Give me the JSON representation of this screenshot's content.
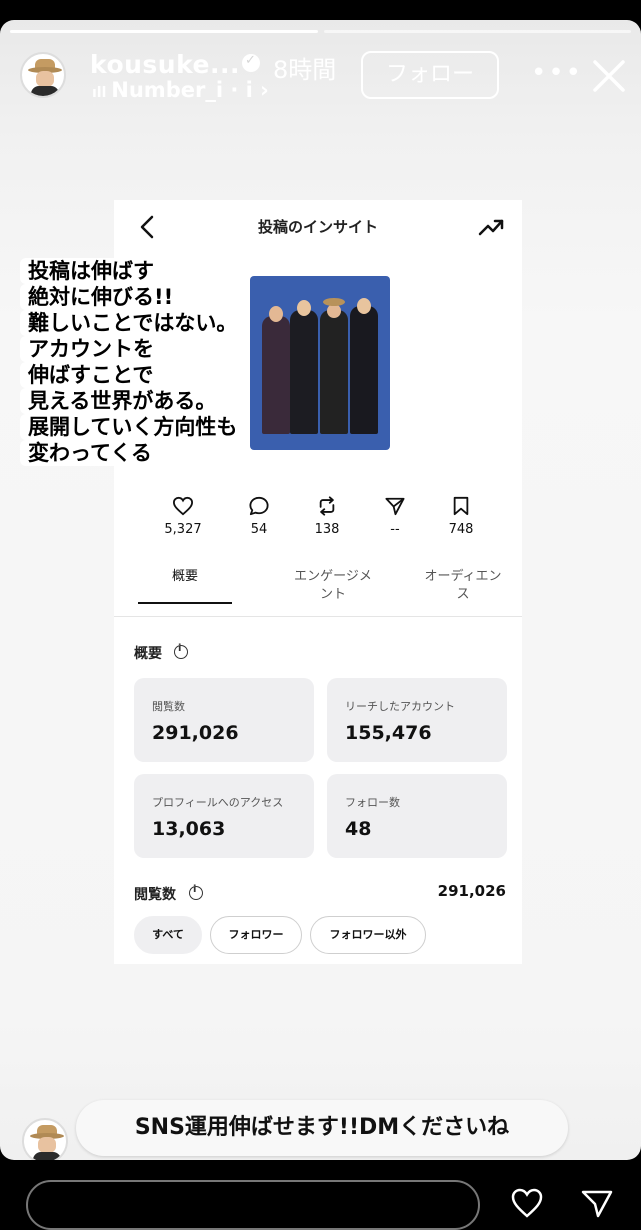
{
  "header": {
    "username": "kousuke...",
    "time_ago": "8時間",
    "music": "Number_i · i ›",
    "follow_label": "フォロー"
  },
  "insights": {
    "title": "投稿のインサイト",
    "stats": [
      {
        "icon": "heart-icon",
        "value": "5,327"
      },
      {
        "icon": "comment-icon",
        "value": "54"
      },
      {
        "icon": "repost-icon",
        "value": "138"
      },
      {
        "icon": "share-icon",
        "value": "--"
      },
      {
        "icon": "bookmark-icon",
        "value": "748"
      }
    ],
    "tabs": [
      "概要",
      "エンゲージメ\nント",
      "オーディエン\nス"
    ],
    "overview_label": "概要",
    "metrics": [
      {
        "label": "閲覧数",
        "value": "291,026"
      },
      {
        "label": "リーチしたアカウント",
        "value": "155,476"
      },
      {
        "label": "プロフィールへのアクセス",
        "value": "13,063"
      },
      {
        "label": "フォロー数",
        "value": "48"
      }
    ],
    "views_label": "閲覧数",
    "views_total": "291,026",
    "filters": [
      "すべて",
      "フォロワー",
      "フォロワー以外"
    ]
  },
  "overlay_lines": [
    "投稿は伸ばす",
    "絶対に伸びる!!",
    "難しいことではない。",
    "アカウントを",
    "伸ばすことで",
    "見える世界がある。",
    "展開していく方向性も",
    "変わってくる"
  ],
  "caption": "SNS運用伸ばせます!!DMくださいね",
  "colors": {
    "story_bg": "#f3f3f3",
    "card_bg": "#ffffff",
    "photo_bg": "#3a5fae",
    "metric_bg": "#efeff1"
  }
}
